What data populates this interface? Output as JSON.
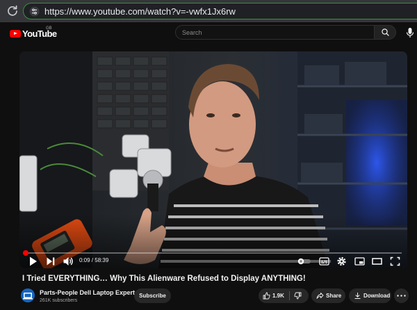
{
  "browser": {
    "url": "https://www.youtube.com/watch?v=-vwfx1Jx6rw",
    "icons": {
      "reload": "reload-icon",
      "site_info": "tune-icon"
    }
  },
  "header": {
    "logo_text": "YouTube",
    "region": "GB",
    "search_placeholder": "Search",
    "icons": {
      "search": "search-icon",
      "mic": "mic-icon"
    },
    "brand_color": "#ff0000"
  },
  "player": {
    "progress_fraction": 0.0026,
    "time_current": "0:09",
    "time_separator": " / ",
    "time_total": "58:39",
    "icons": [
      "play-icon",
      "next-icon",
      "volume-icon",
      "autoplay-toggle-icon",
      "subtitles-icon",
      "settings-icon",
      "miniplayer-icon",
      "theater-icon",
      "fullscreen-icon"
    ]
  },
  "video": {
    "title": "I Tried EVERYTHING… Why This Alienware Refused to Display ANYTHING!"
  },
  "channel": {
    "name": "Parts-People Dell Laptop Experts",
    "subscribers": "261K subscribers",
    "subscribe_label": "Subscribe"
  },
  "actions": {
    "likes": "1.9K",
    "share_label": "Share",
    "download_label": "Download",
    "icons": [
      "like-icon",
      "dislike-icon",
      "share-icon",
      "download-icon",
      "more-icon"
    ]
  }
}
